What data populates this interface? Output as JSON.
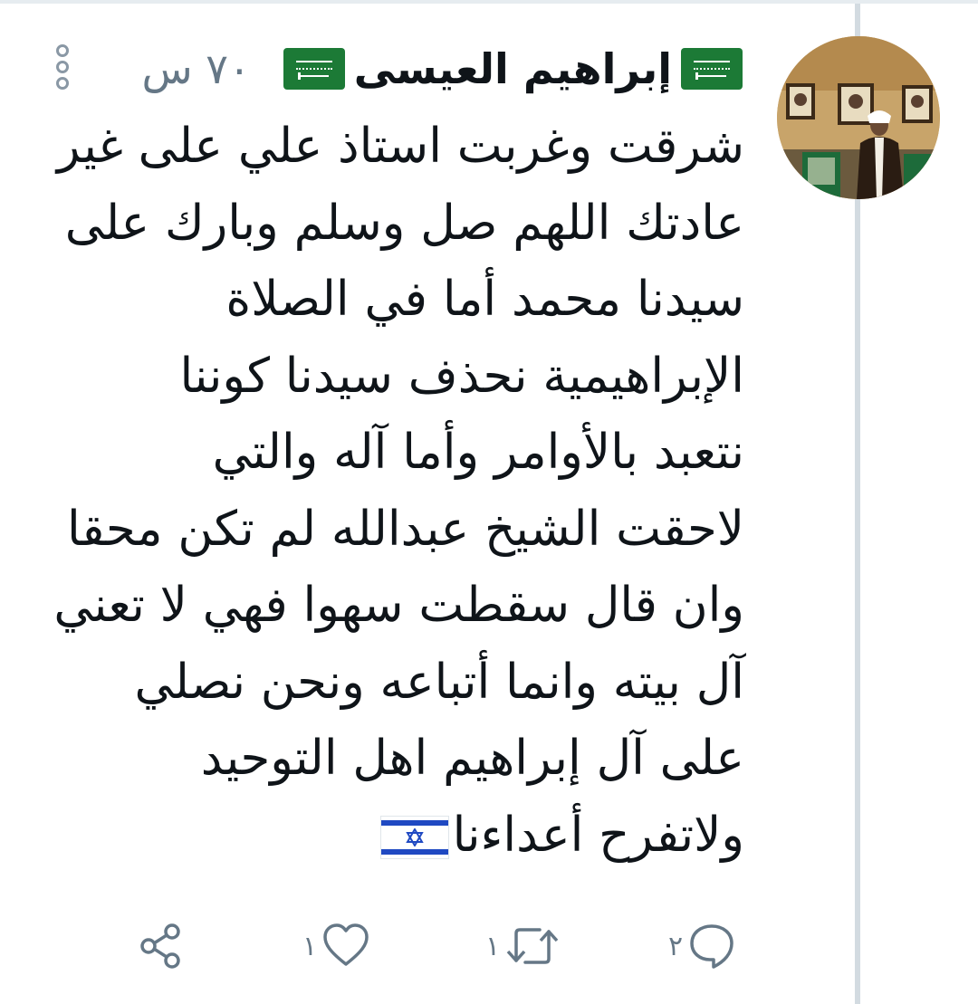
{
  "tweet": {
    "author": {
      "name": "إبراهيم العيسى",
      "avatar": "portrait-photo"
    },
    "timestamp": "٧٠ س",
    "flag_emoji": "saudi-arabia-flag",
    "trailing_emoji": "israel-flag",
    "text_lines": [
      "شرقت وغربت استاذ علي على غير",
      "عادتك اللهم صل وسلم وبارك على",
      "سيدنا محمد أما في الصلاة",
      "الإبراهيمية نحذف سيدنا كوننا",
      "نتعبد بالأوامر وأما آله والتي",
      "لاحقت الشيخ عبدالله لم تكن محقا",
      "وان قال سقطت سهوا فهي لا تعني",
      "آل بيته وانما أتباعه ونحن نصلي",
      "على آل إبراهيم اهل التوحيد",
      "ولاتفرح أعداءنا"
    ],
    "actions": {
      "reply": {
        "icon": "reply-icon",
        "count": "٢"
      },
      "retweet": {
        "icon": "retweet-icon",
        "count": "١"
      },
      "like": {
        "icon": "heart-icon",
        "count": "١"
      },
      "share": {
        "icon": "share-icon"
      }
    }
  },
  "colors": {
    "text": "#0f1419",
    "secondary": "#657786",
    "thread_line": "#d3dbe1",
    "saudi_green": "#1c7a36",
    "israel_blue": "#1f49c2"
  }
}
